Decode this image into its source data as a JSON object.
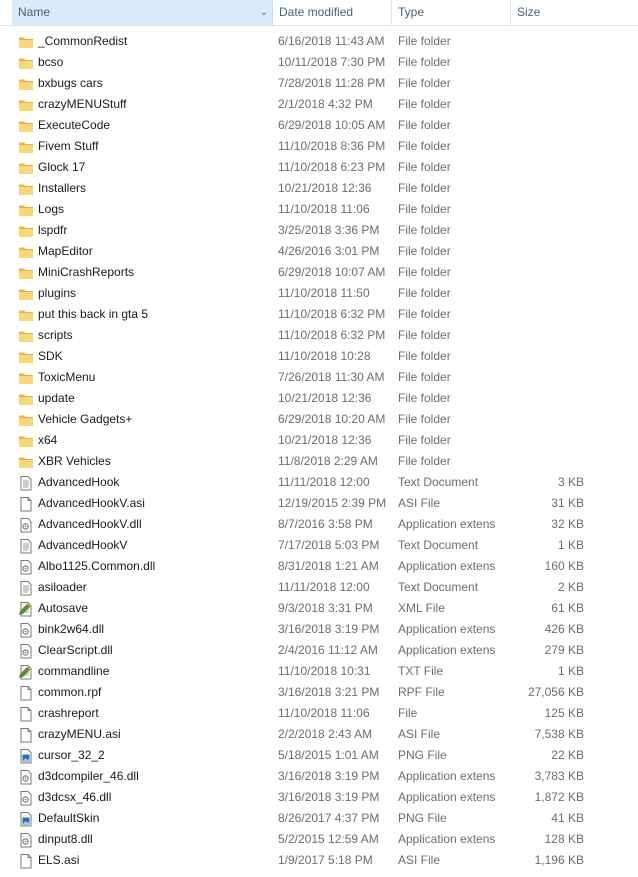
{
  "columns": {
    "name": "Name",
    "date": "Date modified",
    "type": "Type",
    "size": "Size"
  },
  "files": [
    {
      "name": "_CommonRedist",
      "date": "6/16/2018 11:43 AM",
      "type": "File folder",
      "size": "",
      "icon": "folder-icon"
    },
    {
      "name": "bcso",
      "date": "10/11/2018 7:30 PM",
      "type": "File folder",
      "size": "",
      "icon": "folder-icon"
    },
    {
      "name": "bxbugs cars",
      "date": "7/28/2018 11:28 PM",
      "type": "File folder",
      "size": "",
      "icon": "folder-icon"
    },
    {
      "name": "crazyMENUStuff",
      "date": "2/1/2018 4:32 PM",
      "type": "File folder",
      "size": "",
      "icon": "folder-icon"
    },
    {
      "name": "ExecuteCode",
      "date": "6/29/2018 10:05 AM",
      "type": "File folder",
      "size": "",
      "icon": "folder-icon"
    },
    {
      "name": "Fivem Stuff",
      "date": "11/10/2018 8:36 PM",
      "type": "File folder",
      "size": "",
      "icon": "folder-icon"
    },
    {
      "name": "Glock 17",
      "date": "11/10/2018 6:23 PM",
      "type": "File folder",
      "size": "",
      "icon": "folder-icon"
    },
    {
      "name": "Installers",
      "date": "10/21/2018 12:36",
      "type": "File folder",
      "size": "",
      "icon": "folder-icon"
    },
    {
      "name": "Logs",
      "date": "11/10/2018 11:06",
      "type": "File folder",
      "size": "",
      "icon": "folder-icon"
    },
    {
      "name": "lspdfr",
      "date": "3/25/2018 3:36 PM",
      "type": "File folder",
      "size": "",
      "icon": "folder-icon"
    },
    {
      "name": "MapEditor",
      "date": "4/26/2016 3:01 PM",
      "type": "File folder",
      "size": "",
      "icon": "folder-icon"
    },
    {
      "name": "MiniCrashReports",
      "date": "6/29/2018 10:07 AM",
      "type": "File folder",
      "size": "",
      "icon": "folder-icon"
    },
    {
      "name": "plugins",
      "date": "11/10/2018 11:50",
      "type": "File folder",
      "size": "",
      "icon": "folder-icon"
    },
    {
      "name": "put this back in gta 5",
      "date": "11/10/2018 6:32 PM",
      "type": "File folder",
      "size": "",
      "icon": "folder-icon"
    },
    {
      "name": "scripts",
      "date": "11/10/2018 6:32 PM",
      "type": "File folder",
      "size": "",
      "icon": "folder-icon"
    },
    {
      "name": "SDK",
      "date": "11/10/2018 10:28",
      "type": "File folder",
      "size": "",
      "icon": "folder-icon"
    },
    {
      "name": "ToxicMenu",
      "date": "7/26/2018 11:30 AM",
      "type": "File folder",
      "size": "",
      "icon": "folder-icon"
    },
    {
      "name": "update",
      "date": "10/21/2018 12:36",
      "type": "File folder",
      "size": "",
      "icon": "folder-icon"
    },
    {
      "name": "Vehicle Gadgets+",
      "date": "6/29/2018 10:20 AM",
      "type": "File folder",
      "size": "",
      "icon": "folder-icon"
    },
    {
      "name": "x64",
      "date": "10/21/2018 12:36",
      "type": "File folder",
      "size": "",
      "icon": "folder-icon"
    },
    {
      "name": "XBR Vehicles",
      "date": "11/8/2018 2:29 AM",
      "type": "File folder",
      "size": "",
      "icon": "folder-icon"
    },
    {
      "name": "AdvancedHook",
      "date": "11/11/2018 12:00",
      "type": "Text Document",
      "size": "3 KB",
      "icon": "text-document-icon"
    },
    {
      "name": "AdvancedHookV.asi",
      "date": "12/19/2015 2:39 PM",
      "type": "ASI File",
      "size": "31 KB",
      "icon": "blank-file-icon"
    },
    {
      "name": "AdvancedHookV.dll",
      "date": "8/7/2016 3:58 PM",
      "type": "Application extens",
      "size": "32 KB",
      "icon": "dll-file-icon"
    },
    {
      "name": "AdvancedHookV",
      "date": "7/17/2018 5:03 PM",
      "type": "Text Document",
      "size": "1 KB",
      "icon": "text-document-icon"
    },
    {
      "name": "Albo1125.Common.dll",
      "date": "8/31/2018 1:21 AM",
      "type": "Application extens",
      "size": "160 KB",
      "icon": "dll-file-icon"
    },
    {
      "name": "asiloader",
      "date": "11/11/2018 12:00",
      "type": "Text Document",
      "size": "2 KB",
      "icon": "text-document-icon"
    },
    {
      "name": "Autosave",
      "date": "9/3/2018 3:31 PM",
      "type": "XML File",
      "size": "61 KB",
      "icon": "xml-file-icon"
    },
    {
      "name": "bink2w64.dll",
      "date": "3/16/2018 3:19 PM",
      "type": "Application extens",
      "size": "426 KB",
      "icon": "dll-file-icon"
    },
    {
      "name": "ClearScript.dll",
      "date": "2/4/2016 11:12 AM",
      "type": "Application extens",
      "size": "279 KB",
      "icon": "dll-file-icon"
    },
    {
      "name": "commandline",
      "date": "11/10/2018 10:31",
      "type": "TXT File",
      "size": "1 KB",
      "icon": "xml-file-icon"
    },
    {
      "name": "common.rpf",
      "date": "3/16/2018 3:21 PM",
      "type": "RPF File",
      "size": "27,056 KB",
      "icon": "blank-file-icon"
    },
    {
      "name": "crashreport",
      "date": "11/10/2018 11:06",
      "type": "File",
      "size": "125 KB",
      "icon": "blank-file-icon"
    },
    {
      "name": "crazyMENU.asi",
      "date": "2/2/2018 2:43 AM",
      "type": "ASI File",
      "size": "7,538 KB",
      "icon": "blank-file-icon"
    },
    {
      "name": "cursor_32_2",
      "date": "5/18/2015 1:01 AM",
      "type": "PNG File",
      "size": "22 KB",
      "icon": "png-file-icon"
    },
    {
      "name": "d3dcompiler_46.dll",
      "date": "3/16/2018 3:19 PM",
      "type": "Application extens",
      "size": "3,783 KB",
      "icon": "dll-file-icon"
    },
    {
      "name": "d3dcsx_46.dll",
      "date": "3/16/2018 3:19 PM",
      "type": "Application extens",
      "size": "1,872 KB",
      "icon": "dll-file-icon"
    },
    {
      "name": "DefaultSkin",
      "date": "8/26/2017 4:37 PM",
      "type": "PNG File",
      "size": "41 KB",
      "icon": "png-file-icon"
    },
    {
      "name": "dinput8.dll",
      "date": "5/2/2015 12:59 AM",
      "type": "Application extens",
      "size": "128 KB",
      "icon": "dll-file-icon"
    },
    {
      "name": "ELS.asi",
      "date": "1/9/2017 5:18 PM",
      "type": "ASI File",
      "size": "1,196 KB",
      "icon": "blank-file-icon"
    }
  ]
}
